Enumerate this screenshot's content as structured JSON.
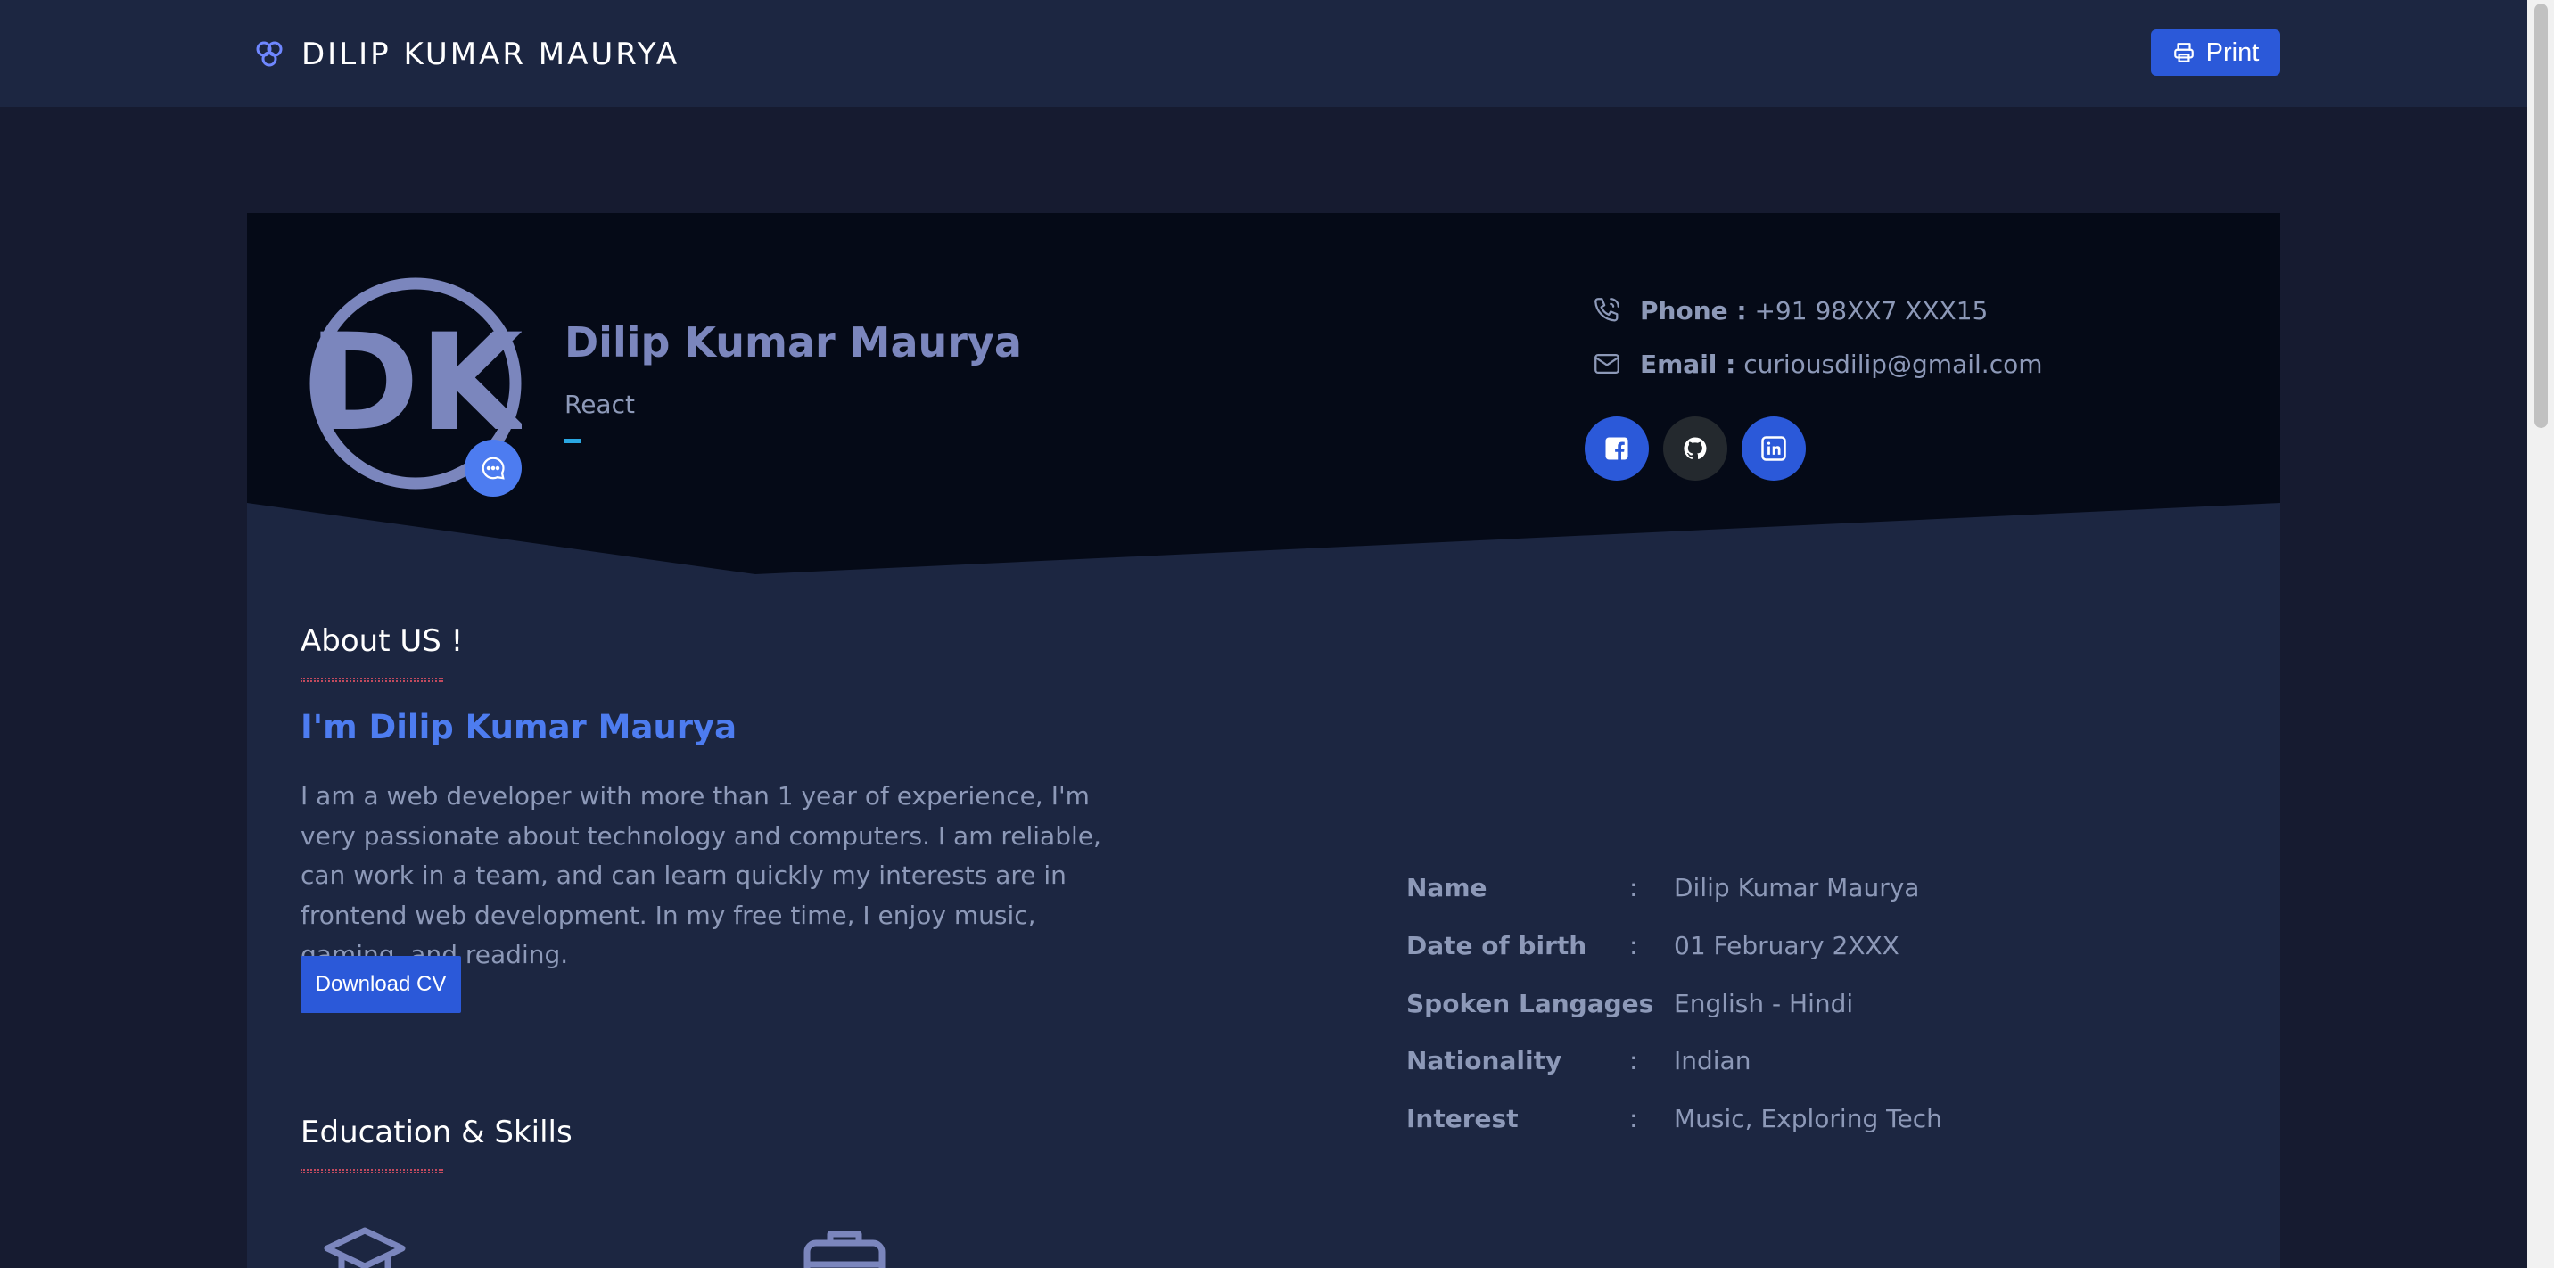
{
  "navbar": {
    "brand": "DILIP KUMAR MAURYA",
    "print_label": "Print"
  },
  "hero": {
    "logo_text": "DK",
    "name": "Dilip Kumar Maurya",
    "role": "React",
    "phone_label": "Phone :",
    "phone_value": "+91 98XX7 XXX15",
    "email_label": "Email :",
    "email_value": "curiousdilip@gmail.com",
    "social": [
      {
        "name": "facebook",
        "color": "#2b59d9"
      },
      {
        "name": "github",
        "color": "#24292e"
      },
      {
        "name": "linkedin",
        "color": "#2b59d9"
      }
    ]
  },
  "about": {
    "title": "About US !",
    "heading": "I'm Dilip Kumar Maurya",
    "text": "I am a web developer with more than 1 year of experience, I'm very passionate about technology and computers. I am reliable, can work in a team, and can learn quickly my interests are in frontend web development. In my free time, I enjoy music, gaming, and reading.",
    "download_label": "Download CV",
    "info": [
      {
        "label": "Name",
        "sep": ":",
        "value": "Dilip Kumar Maurya"
      },
      {
        "label": "Date of birth",
        "sep": ":",
        "value": "01 February 2XXX"
      },
      {
        "label": "Spoken Langages",
        "sep": ":",
        "value": "English - Hindi"
      },
      {
        "label": "Nationality",
        "sep": ":",
        "value": "Indian"
      },
      {
        "label": "Interest",
        "sep": ":",
        "value": "Music, Exploring Tech"
      }
    ]
  },
  "education": {
    "title": "Education & Skills",
    "icons": [
      "graduation-cap-icon",
      "briefcase-icon"
    ]
  },
  "colors": {
    "page_bg": "#161b30",
    "nav_bg": "#1c2641",
    "card_bg": "#1c2641",
    "hero_bg": "#050a17",
    "accent_blue": "#2b59d9",
    "heading_blue": "#4d7cf0",
    "logo_color": "#7b86bd",
    "underline_red": "#c24a5e"
  }
}
